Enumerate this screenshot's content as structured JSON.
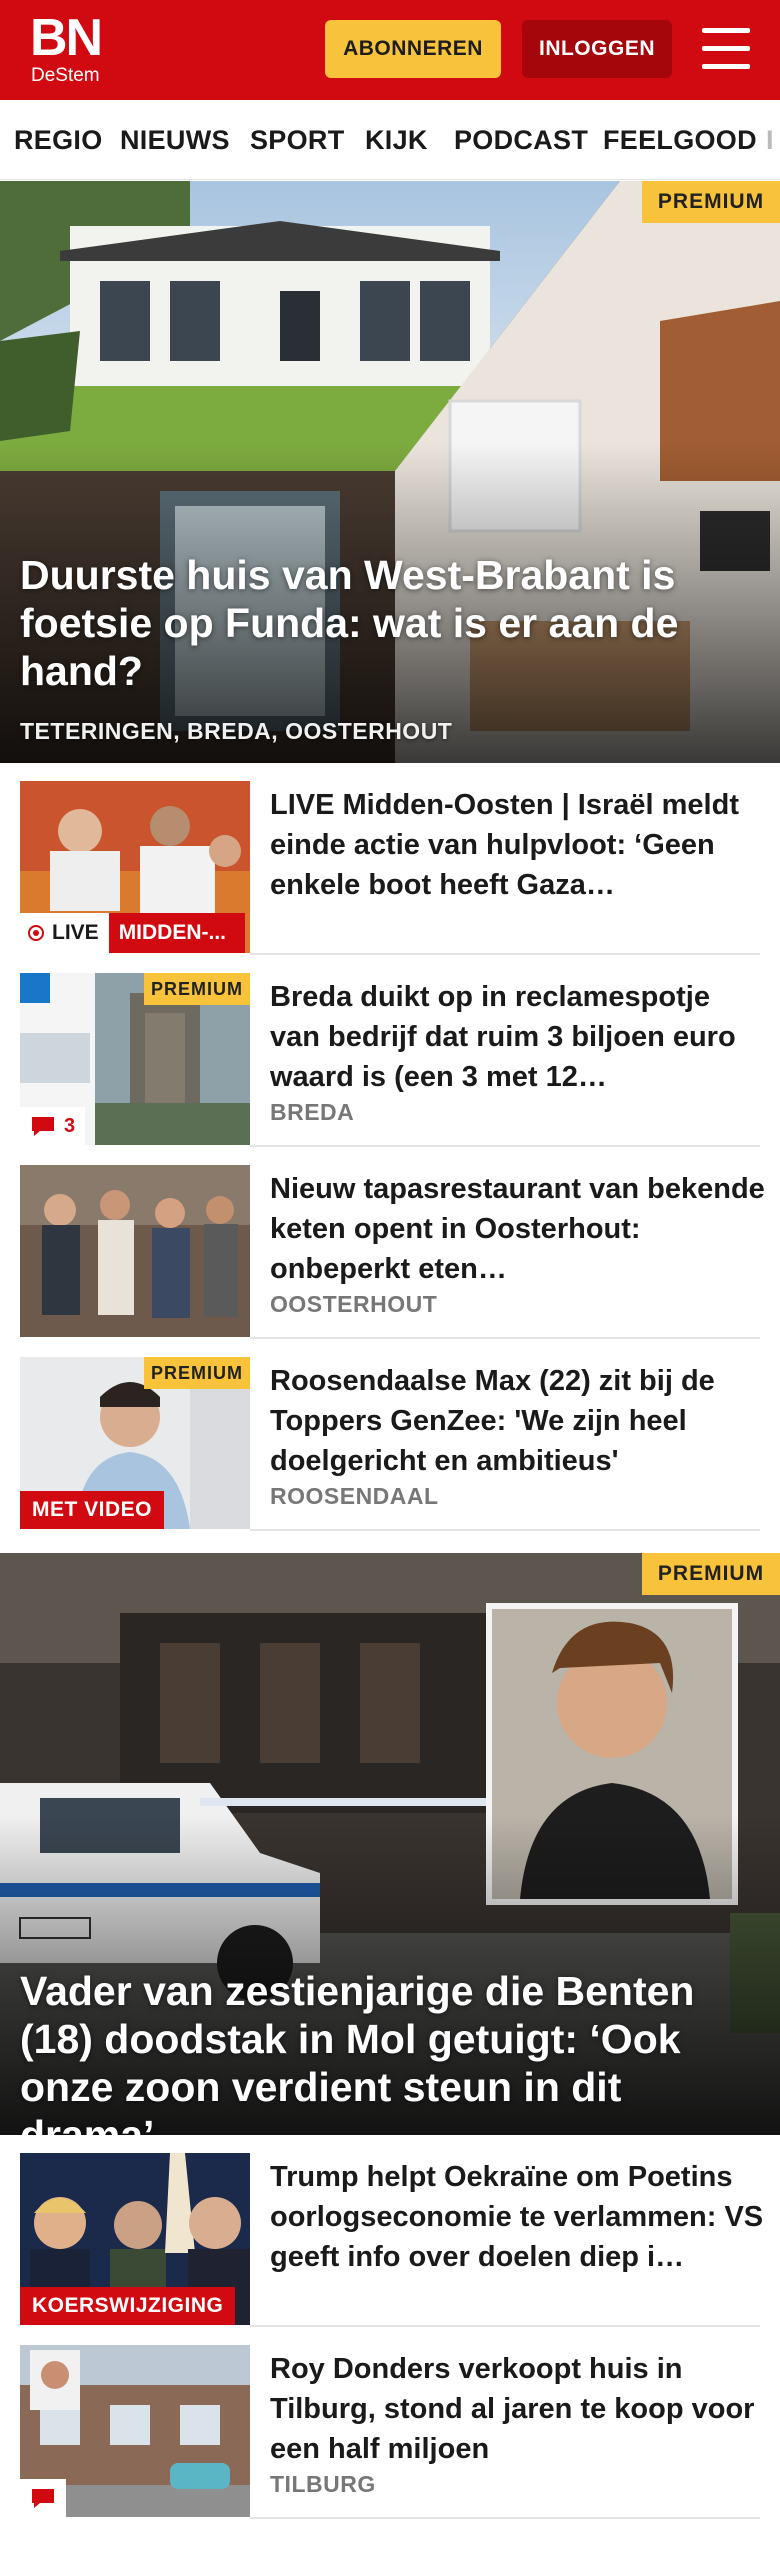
{
  "header": {
    "logo_main": "BN",
    "logo_sub": "DeStem",
    "subscribe_label": "ABONNEREN",
    "login_label": "INLOGGEN",
    "menu_icon": "hamburger-menu-icon"
  },
  "nav": {
    "items": [
      "REGIO",
      "NIEUWS",
      "SPORT",
      "KIJK",
      "PODCAST",
      "FEELGOOD",
      "I"
    ]
  },
  "hero1": {
    "badge": "PREMIUM",
    "title": "Duurste huis van West-Brabant is foetsie op Funda: wat is er aan de hand?",
    "locations": "TETERINGEN, BREDA, OOSTERHOUT"
  },
  "articles1": [
    {
      "headline": "LIVE Midden-Oosten | Israël meldt einde actie van hulpvloot: ‘Geen enkele boot heeft Gaza…",
      "live_label": "LIVE",
      "category_label": "MIDDEN-..."
    },
    {
      "headline": "Breda duikt op in reclamespotje van bedrijf dat ruim 3 biljoen euro waard is (een 3 met 12…",
      "premium": "PREMIUM",
      "comments": "3",
      "location": "BREDA"
    },
    {
      "headline": "Nieuw tapasrestaurant van bekende keten opent in Oosterhout: onbeperkt eten…",
      "location": "OOSTERHOUT"
    },
    {
      "headline": "Roosendaalse Max (22) zit bij de Toppers GenZee: 'We zijn heel doelgericht en ambitieus'",
      "premium": "PREMIUM",
      "video_label": "MET VIDEO",
      "location": "ROOSENDAAL"
    }
  ],
  "hero2": {
    "badge": "PREMIUM",
    "title": "Vader van zestienjarige die Benten (18) doodstak in Mol getuigt: ‘Ook onze zoon verdient steun in dit drama’"
  },
  "articles2": [
    {
      "headline": "Trump helpt Oekraïne om Poetins oorlogseconomie te verlammen: VS geeft info over doelen diep i…",
      "tag": "KOERSWIJZIGING"
    },
    {
      "headline": "Roy Donders verkoopt huis in Tilburg, stond al jaren te koop voor een half miljoen",
      "location": "TILBURG"
    }
  ],
  "colors": {
    "brand_red": "#d10a11",
    "premium_yellow": "#f8c33a",
    "login_dark_red": "#a5060b"
  }
}
